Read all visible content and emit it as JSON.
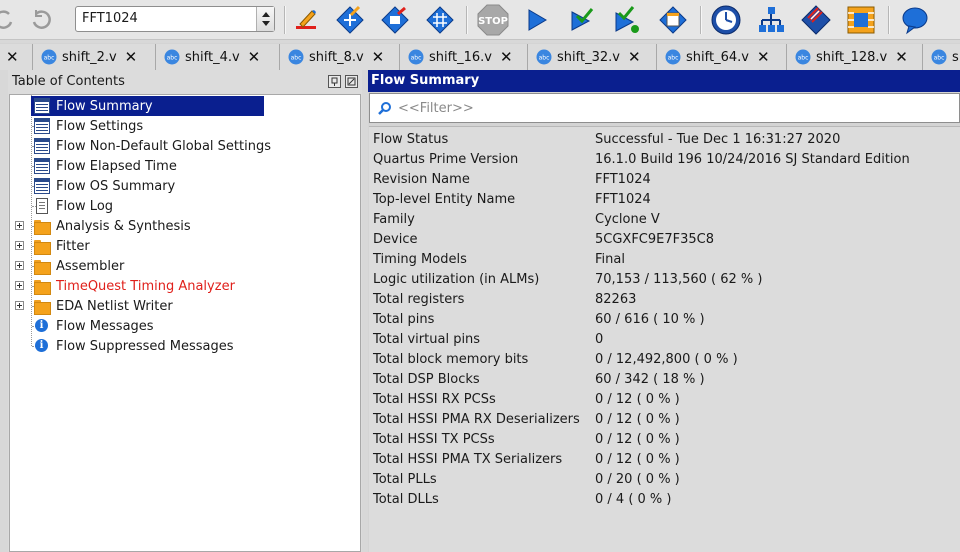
{
  "toolbar": {
    "revision": "FFT1024",
    "icons": [
      "back-icon",
      "forward-icon",
      "edit-settings-icon",
      "analysis-icon",
      "compile-icon",
      "fitter-icon",
      "stop-icon",
      "start-compilation-icon",
      "check-icon",
      "program-check-icon",
      "report-icon",
      "timequest-icon",
      "netlist-viewer-icon",
      "assignment-icon",
      "chip-planner-icon",
      "help-icon"
    ],
    "stop_label": "STOP"
  },
  "tabs": [
    {
      "label": ""
    },
    {
      "label": "shift_2.v"
    },
    {
      "label": "shift_4.v"
    },
    {
      "label": "shift_8.v"
    },
    {
      "label": "shift_16.v"
    },
    {
      "label": "shift_32.v"
    },
    {
      "label": "shift_64.v"
    },
    {
      "label": "shift_128.v"
    },
    {
      "label": "s"
    }
  ],
  "toc": {
    "title": "Table of Contents",
    "items": [
      {
        "label": "Flow Summary",
        "icon": "table-icon",
        "selected": true
      },
      {
        "label": "Flow Settings",
        "icon": "table-icon"
      },
      {
        "label": "Flow Non-Default Global Settings",
        "icon": "table-icon"
      },
      {
        "label": "Flow Elapsed Time",
        "icon": "table-icon"
      },
      {
        "label": "Flow OS Summary",
        "icon": "table-icon"
      },
      {
        "label": "Flow Log",
        "icon": "document-icon"
      },
      {
        "label": "Analysis & Synthesis",
        "icon": "folder-icon",
        "expandable": true
      },
      {
        "label": "Fitter",
        "icon": "folder-icon",
        "expandable": true
      },
      {
        "label": "Assembler",
        "icon": "folder-icon",
        "expandable": true
      },
      {
        "label": "TimeQuest Timing Analyzer",
        "icon": "folder-icon",
        "expandable": true,
        "color": "#e0201b"
      },
      {
        "label": "EDA Netlist Writer",
        "icon": "folder-icon",
        "expandable": true
      },
      {
        "label": "Flow Messages",
        "icon": "info-icon"
      },
      {
        "label": "Flow Suppressed Messages",
        "icon": "info-icon"
      }
    ]
  },
  "report": {
    "title": "Flow Summary",
    "filter_placeholder": "<<Filter>>",
    "rows": [
      {
        "key": "Flow Status",
        "value": "Successful - Tue Dec  1 16:31:27 2020"
      },
      {
        "key": "Quartus Prime Version",
        "value": "16.1.0 Build 196 10/24/2016 SJ Standard Edition"
      },
      {
        "key": "Revision Name",
        "value": "FFT1024"
      },
      {
        "key": "Top-level Entity Name",
        "value": "FFT1024"
      },
      {
        "key": "Family",
        "value": "Cyclone V"
      },
      {
        "key": "Device",
        "value": "5CGXFC9E7F35C8"
      },
      {
        "key": "Timing Models",
        "value": "Final"
      },
      {
        "key": "Logic utilization (in ALMs)",
        "value": "70,153 / 113,560 ( 62 % )"
      },
      {
        "key": "Total registers",
        "value": "82263"
      },
      {
        "key": "Total pins",
        "value": "60 / 616 ( 10 % )"
      },
      {
        "key": "Total virtual pins",
        "value": "0"
      },
      {
        "key": "Total block memory bits",
        "value": "0 / 12,492,800 ( 0 % )"
      },
      {
        "key": "Total DSP Blocks",
        "value": "60 / 342 ( 18 % )"
      },
      {
        "key": "Total HSSI RX PCSs",
        "value": "0 / 12 ( 0 % )"
      },
      {
        "key": "Total HSSI PMA RX Deserializers",
        "value": "0 / 12 ( 0 % )"
      },
      {
        "key": "Total HSSI TX PCSs",
        "value": "0 / 12 ( 0 % )"
      },
      {
        "key": "Total HSSI PMA TX Serializers",
        "value": "0 / 12 ( 0 % )"
      },
      {
        "key": "Total PLLs",
        "value": "0 / 20 ( 0 % )"
      },
      {
        "key": "Total DLLs",
        "value": "0 / 4 ( 0 % )"
      }
    ]
  },
  "colors": {
    "selection": "#0a1f8f",
    "warning_text": "#e0201b",
    "folder": "#f4a21c"
  }
}
